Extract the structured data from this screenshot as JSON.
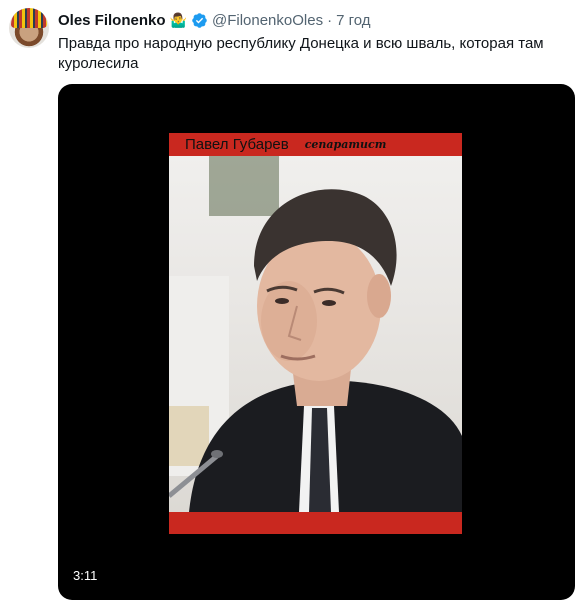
{
  "author": {
    "name": "Oles Filonenko",
    "emoji": "🤷‍♂️",
    "handle": "@FilonenkoOles",
    "separator": "·",
    "time": "7 год"
  },
  "tweet": {
    "text": "Правда про народную республику Донецка и всю шваль, которая там куролесила"
  },
  "video": {
    "caption_name": "Павел Губарев",
    "caption_tag": "сепаратист",
    "duration": "3:11"
  },
  "colors": {
    "verified": "#1d9bf0",
    "caption_bar": "#c9281f",
    "media_bg": "#000000"
  }
}
